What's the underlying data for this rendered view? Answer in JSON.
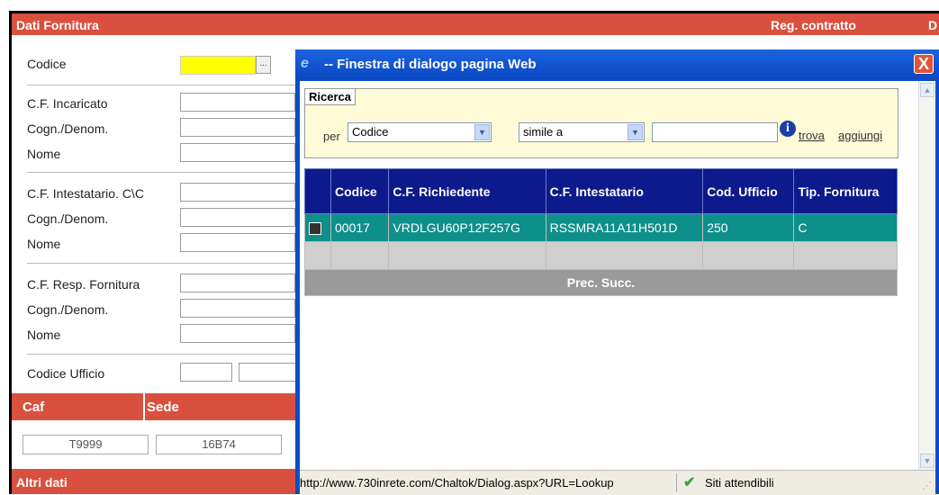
{
  "background": {
    "header_left": "Dati Fornitura",
    "header_mid": "Reg. contratto",
    "header_right": "D",
    "fields": {
      "codice": "Codice",
      "cf_incaricato": "C.F. Incaricato",
      "cogn1": "Cogn./Denom.",
      "nome1": "Nome",
      "cf_intestatario": "C.F. Intestatario. C\\C",
      "cogn2": "Cogn./Denom.",
      "nome2": "Nome",
      "cf_resp": "C.F. Resp. Fornitura",
      "cogn3": "Cogn./Denom.",
      "nome3": "Nome",
      "codice_ufficio": "Codice Ufficio"
    },
    "lookup_button": "...",
    "caf_label": "Caf",
    "sede_label": "Sede",
    "caf_value": "T9999",
    "sede_value": "16B74",
    "altri_dati": "Altri dati"
  },
  "dialog": {
    "title": "-- Finestra di dialogo pagina Web",
    "close": "X",
    "search": {
      "tab": "Ricerca",
      "per": "per",
      "field_select": "Codice",
      "operator_select": "simile a",
      "value": "",
      "info": "i",
      "trova": "trova",
      "aggiungi": "aggiungi"
    },
    "table": {
      "headers": [
        "Codice",
        "C.F. Richiedente",
        "C.F. Intestatario",
        "Cod. Ufficio",
        "Tip. Fornitura"
      ],
      "rows": [
        [
          "00017",
          "VRDLGU60P12F257G",
          "RSSMRA11A11H501D",
          "250",
          "C"
        ]
      ],
      "footer": "Prec. Succ."
    },
    "status": {
      "url": "http://www.730inrete.com/Chaltok/Dialog.aspx?URL=Lookup",
      "zone": "Siti attendibili"
    }
  },
  "colors": {
    "red_bar": "#d9503f",
    "dialog_title": "#0a4ec6",
    "table_header": "#0c1a8c",
    "selected_row": "#0e8f8a",
    "search_bg": "#fffbd6"
  }
}
